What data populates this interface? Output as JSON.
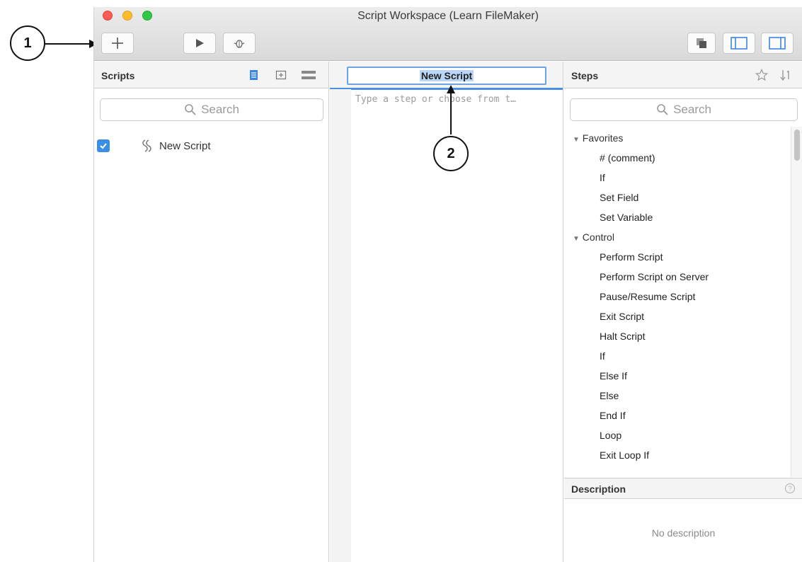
{
  "window": {
    "title": "Script Workspace (Learn FileMaker)"
  },
  "toolbar": {
    "add_icon": "plus-icon",
    "run_icon": "play-icon",
    "debug_icon": "bug-icon"
  },
  "scripts_pane": {
    "header": "Scripts",
    "search_placeholder": "Search",
    "items": [
      {
        "name": "New Script",
        "checked": true
      }
    ]
  },
  "editor": {
    "script_name": "New Script",
    "placeholder": "Type a step or choose from t…"
  },
  "steps_pane": {
    "header": "Steps",
    "search_placeholder": "Search",
    "categories": [
      {
        "label": "Favorites",
        "steps": [
          "# (comment)",
          "If",
          "Set Field",
          "Set Variable"
        ]
      },
      {
        "label": "Control",
        "steps": [
          "Perform Script",
          "Perform Script on Server",
          "Pause/Resume Script",
          "Exit Script",
          "Halt Script",
          "If",
          "Else If",
          "Else",
          "End If",
          "Loop",
          "Exit Loop If"
        ]
      }
    ],
    "description_header": "Description",
    "description_text": "No description"
  },
  "callouts": {
    "one": "1",
    "two": "2"
  },
  "colors": {
    "accent": "#4a90e2",
    "checkbox": "#3b8ee6"
  }
}
